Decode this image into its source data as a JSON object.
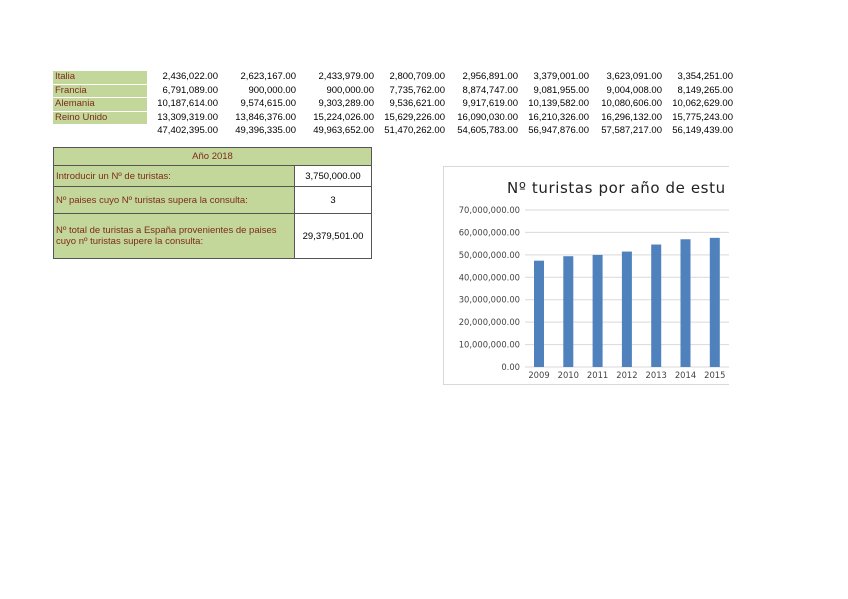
{
  "table": {
    "rows": [
      {
        "country": "Italia",
        "values": [
          "2,436,022.00",
          "2,623,167.00",
          "2,433,979.00",
          "2,800,709.00",
          "2,956,891.00",
          "3,379,001.00",
          "3,623,091.00",
          "3,354,251.00"
        ]
      },
      {
        "country": "Francia",
        "values": [
          "6,791,089.00",
          "900,000.00",
          "900,000.00",
          "7,735,762.00",
          "8,874,747.00",
          "9,081,955.00",
          "9,004,008.00",
          "8,149,265.00"
        ]
      },
      {
        "country": "Alemania",
        "values": [
          "10,187,614.00",
          "9,574,615.00",
          "9,303,289.00",
          "9,536,621.00",
          "9,917,619.00",
          "10,139,582.00",
          "10,080,606.00",
          "10,062,629.00"
        ]
      },
      {
        "country": "Reino Unido",
        "values": [
          "13,309,319.00",
          "13,846,376.00",
          "15,224,026.00",
          "15,629,226.00",
          "16,090,030.00",
          "16,210,326.00",
          "16,296,132.00",
          "15,775,243.00"
        ]
      }
    ],
    "totals": [
      "47,402,395.00",
      "49,396,335.00",
      "49,963,652.00",
      "51,470,262.00",
      "54,605,783.00",
      "56,947,876.00",
      "57,587,217.00",
      "56,149,439.00"
    ]
  },
  "query": {
    "header": "Año 2018",
    "label_input": "Introducir un Nº de turistas:",
    "value_input": "3,750,000.00",
    "label_count": "Nº paises cuyo Nº turistas supera la consulta:",
    "value_count": "3",
    "label_total": "Nº total de turistas a España provenientes de paises cuyo nº turistas supere la consulta:",
    "value_total": "29,379,501.00"
  },
  "chart_data": {
    "type": "bar",
    "title": "Nº turistas por año de estu",
    "categories": [
      "2009",
      "2010",
      "2011",
      "2012",
      "2013",
      "2014",
      "2015"
    ],
    "values": [
      47402395,
      49396335,
      49963652,
      51470262,
      54605783,
      56947876,
      57587217
    ],
    "ylim": [
      0,
      70000000
    ],
    "yticks": [
      "0.00",
      "10,000,000.00",
      "20,000,000.00",
      "30,000,000.00",
      "40,000,000.00",
      "50,000,000.00",
      "60,000,000.00",
      "70,000,000.00"
    ],
    "grid": true,
    "bar_color": "#4f81bd"
  }
}
